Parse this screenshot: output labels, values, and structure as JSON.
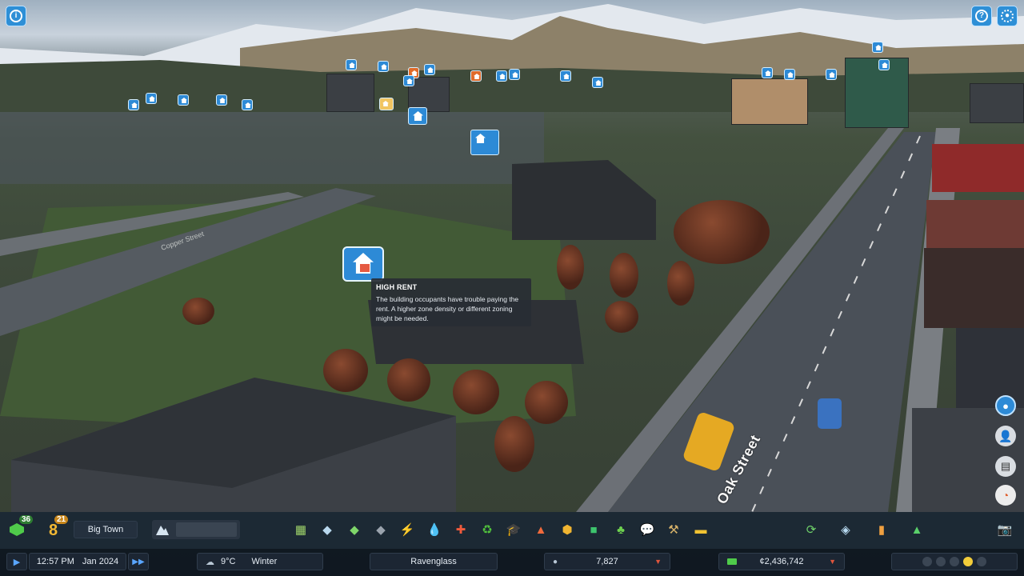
{
  "top_buttons": {
    "left_info_icon": "info-icon",
    "right_help_icon": "help-icon",
    "right_settings_icon": "gear-icon"
  },
  "tooltip": {
    "title": "HIGH RENT",
    "body": "The building occupants have trouble paying the rent. A higher zone density or different zoning might be needed."
  },
  "streets": {
    "main": "Oak Street",
    "faint": "Copper Street"
  },
  "progression": {
    "xp_level": "36",
    "milestone_level": "21",
    "milestone_digit": "8",
    "city_rank": "Big Town"
  },
  "toolbar": {
    "tools": [
      {
        "name": "zoning-tool",
        "glyph": "▦",
        "color": "#9fd46a"
      },
      {
        "name": "area-tool",
        "glyph": "◆",
        "color": "#b9d8ee"
      },
      {
        "name": "landscaping-tool",
        "glyph": "◆",
        "color": "#7fd66a"
      },
      {
        "name": "roads-tool",
        "glyph": "◆",
        "color": "#9aa3ad"
      },
      {
        "name": "electricity-tool",
        "glyph": "⚡",
        "color": "#f5c542"
      },
      {
        "name": "water-tool",
        "glyph": "💧",
        "color": "#49a7f0"
      },
      {
        "name": "healthcare-tool",
        "glyph": "✚",
        "color": "#f05a3c"
      },
      {
        "name": "garbage-tool",
        "glyph": "♻",
        "color": "#52c43d"
      },
      {
        "name": "education-tool",
        "glyph": "🎓",
        "color": "#cfd7e0"
      },
      {
        "name": "fire-tool",
        "glyph": "▲",
        "color": "#f06a3c"
      },
      {
        "name": "police-tool",
        "glyph": "⬢",
        "color": "#f1b531"
      },
      {
        "name": "transport-tool",
        "glyph": "■",
        "color": "#3dc46d"
      },
      {
        "name": "parks-tool",
        "glyph": "♣",
        "color": "#6ed14f"
      },
      {
        "name": "communications-tool",
        "glyph": "💬",
        "color": "#e9eef3"
      },
      {
        "name": "landscape-shovel-tool",
        "glyph": "⚒",
        "color": "#d8b36a"
      },
      {
        "name": "bulldozer-tool",
        "glyph": "▬",
        "color": "#f1c232"
      }
    ],
    "right_tools": [
      {
        "name": "economy-cycle-tool",
        "glyph": "⟳",
        "color": "#6fd16a"
      },
      {
        "name": "map-tool",
        "glyph": "◈",
        "color": "#b7d9f0"
      },
      {
        "name": "statistics-tool",
        "glyph": "▮",
        "color": "#f0a040"
      },
      {
        "name": "progression-tool",
        "glyph": "▲",
        "color": "#5ad06a"
      },
      {
        "name": "photo-mode-tool",
        "glyph": "📷",
        "color": "#c9d3de"
      }
    ]
  },
  "status": {
    "time": "12:57 PM",
    "date": "Jan 2024",
    "temperature": "9°C",
    "season": "Winter",
    "city_name": "Ravenglass",
    "population": "7,827",
    "money": "¢2,436,742"
  },
  "colors": {
    "accent": "#2d8ad6",
    "toolbar_bg": "#162434",
    "money_green": "#4fcb4a",
    "warning_red": "#e0553c"
  }
}
